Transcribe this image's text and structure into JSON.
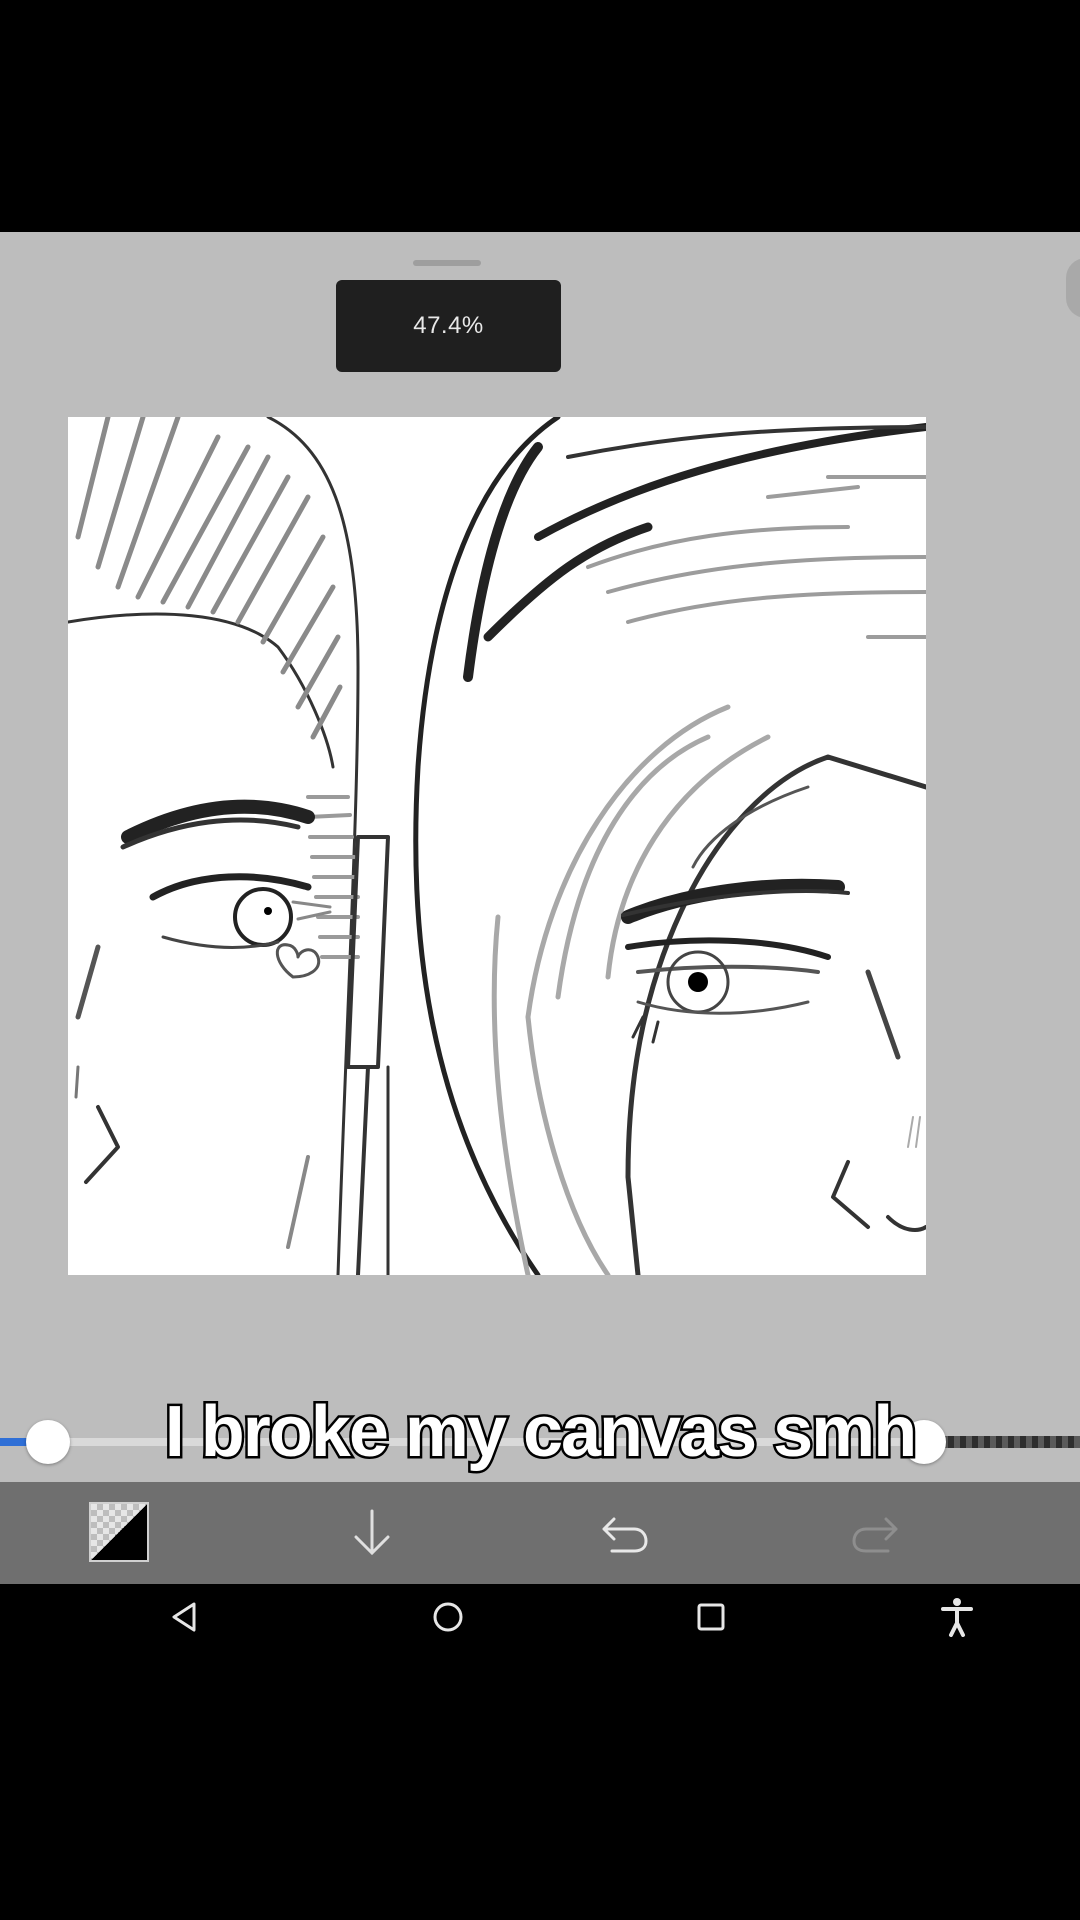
{
  "zoom": {
    "label": "47.4%"
  },
  "caption": {
    "text": "I broke my canvas smh"
  },
  "brush": {
    "size_fraction": 0.02,
    "opacity_fraction": 0.83
  },
  "toolbar": {
    "color_swatch": {
      "icon": "color-swatch-icon",
      "primary": "#000000",
      "secondary": "transparent"
    },
    "layer_down": {
      "icon": "arrow-down-icon"
    },
    "undo": {
      "icon": "undo-icon"
    },
    "redo": {
      "icon": "redo-icon",
      "enabled": false
    }
  },
  "navbar": {
    "back": {
      "icon": "back-triangle-icon"
    },
    "home": {
      "icon": "home-circle-icon"
    },
    "recents": {
      "icon": "recents-square-icon"
    },
    "accessibility": {
      "icon": "accessibility-icon"
    }
  },
  "colors": {
    "workspace": "#bdbdbd",
    "toolbar": "#6f6f6f",
    "accent": "#2f6fd6"
  }
}
